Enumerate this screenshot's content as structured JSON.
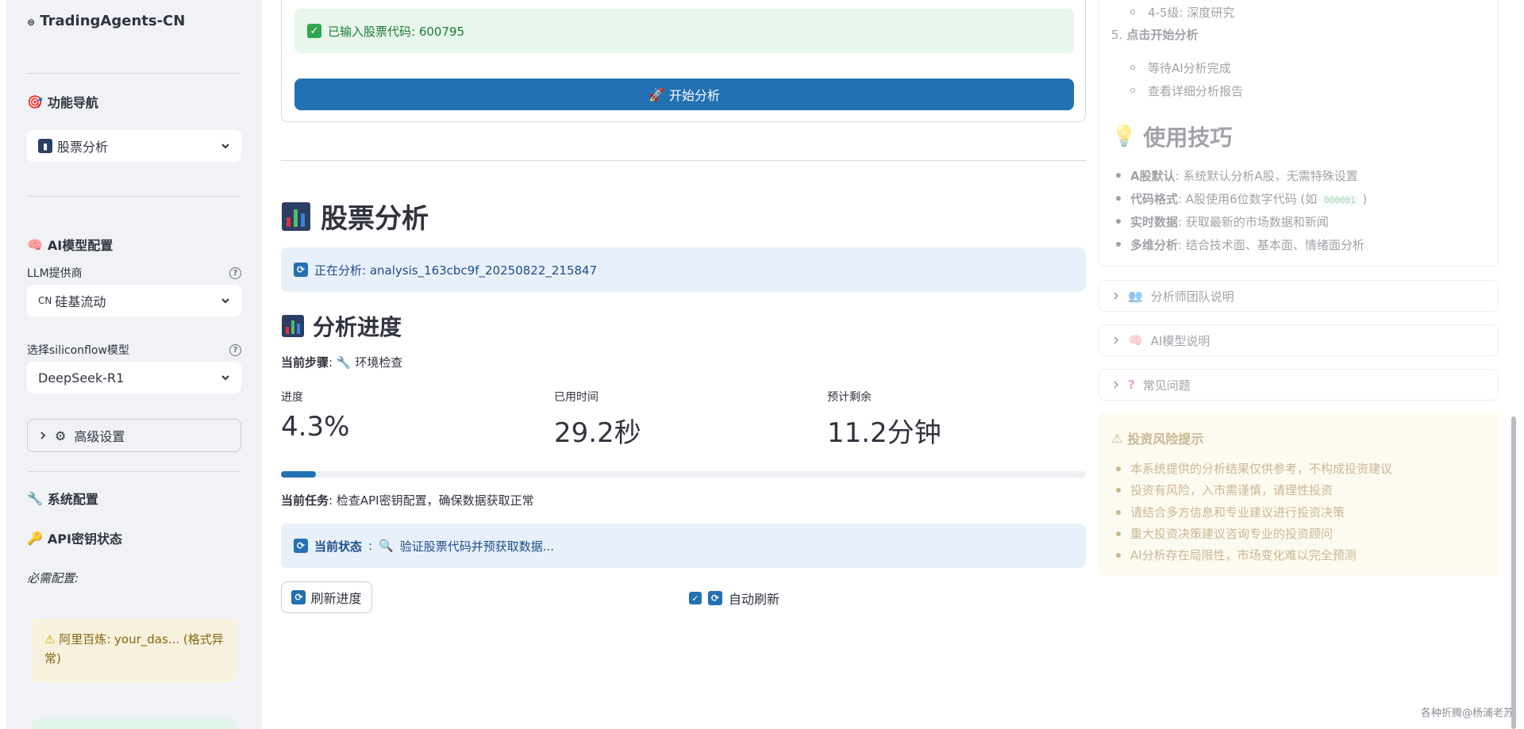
{
  "sidebar": {
    "brand": "TradingAgents-CN",
    "nav_heading": "功能导航",
    "nav_select": "股票分析",
    "ai_heading": "AI模型配置",
    "llm_label": "LLM提供商",
    "llm_prefix": "CN",
    "llm_value": "硅基流动",
    "model_label": "选择siliconflow模型",
    "model_value": "DeepSeek-R1",
    "advanced_label": "高级设置",
    "system_heading": "系统配置",
    "api_heading": "API密钥状态",
    "required_label": "必需配置:",
    "warning_text": "阿里百炼: your_das... (格式异常)"
  },
  "main": {
    "success_message": "已输入股票代码: 600795",
    "start_button": "开始分析",
    "title": "股票分析",
    "analyzing_text": "正在分析: analysis_163cbc9f_20250822_215847",
    "progress_heading": "分析进度",
    "current_step_label": "当前步骤",
    "current_step_value": "环境检查",
    "metrics": [
      {
        "label": "进度",
        "value": "4.3%"
      },
      {
        "label": "已用时间",
        "value": "29.2秒"
      },
      {
        "label": "预计剩余",
        "value": "11.2分钟"
      }
    ],
    "progress_fraction": 0.043,
    "current_task_label": "当前任务",
    "current_task_value": "检查API密钥配置，确保数据获取正常",
    "current_status_label": "当前状态",
    "current_status_value": "验证股票代码并预获取数据...",
    "refresh_button": "刷新进度",
    "auto_refresh_label": "自动刷新",
    "auto_refresh_checked": true
  },
  "right": {
    "sub_item_top": "4-5级: 深度研究",
    "step5_num": "5.",
    "step5": "点击开始分析",
    "step5_items": [
      "等待AI分析完成",
      "查看详细分析报告"
    ],
    "tips_heading": "使用技巧",
    "tips": [
      {
        "bold": "A股默认",
        "text": ": 系统默认分析A股，无需特殊设置"
      },
      {
        "bold": "代码格式",
        "text": ": A股使用6位数字代码 (如 ",
        "code": "000001",
        "tail": " )"
      },
      {
        "bold": "实时数据",
        "text": ": 获取最新的市场数据和新闻"
      },
      {
        "bold": "多维分析",
        "text": ": 结合技术面、基本面、情绪面分析"
      }
    ],
    "expanders": [
      "分析师团队说明",
      "AI模型说明",
      "常见问题"
    ],
    "risk_title": "投资风险提示",
    "risk_items": [
      "本系统提供的分析结果仅供参考，不构成投资建议",
      "投资有风险，入市需谨慎，请理性投资",
      "请结合多方信息和专业建议进行投资决策",
      "重大投资决策建议咨询专业的投资顾问",
      "AI分析存在局限性，市场变化难以完全预测"
    ]
  },
  "watermark": "各种折腾@杨浦老苏"
}
